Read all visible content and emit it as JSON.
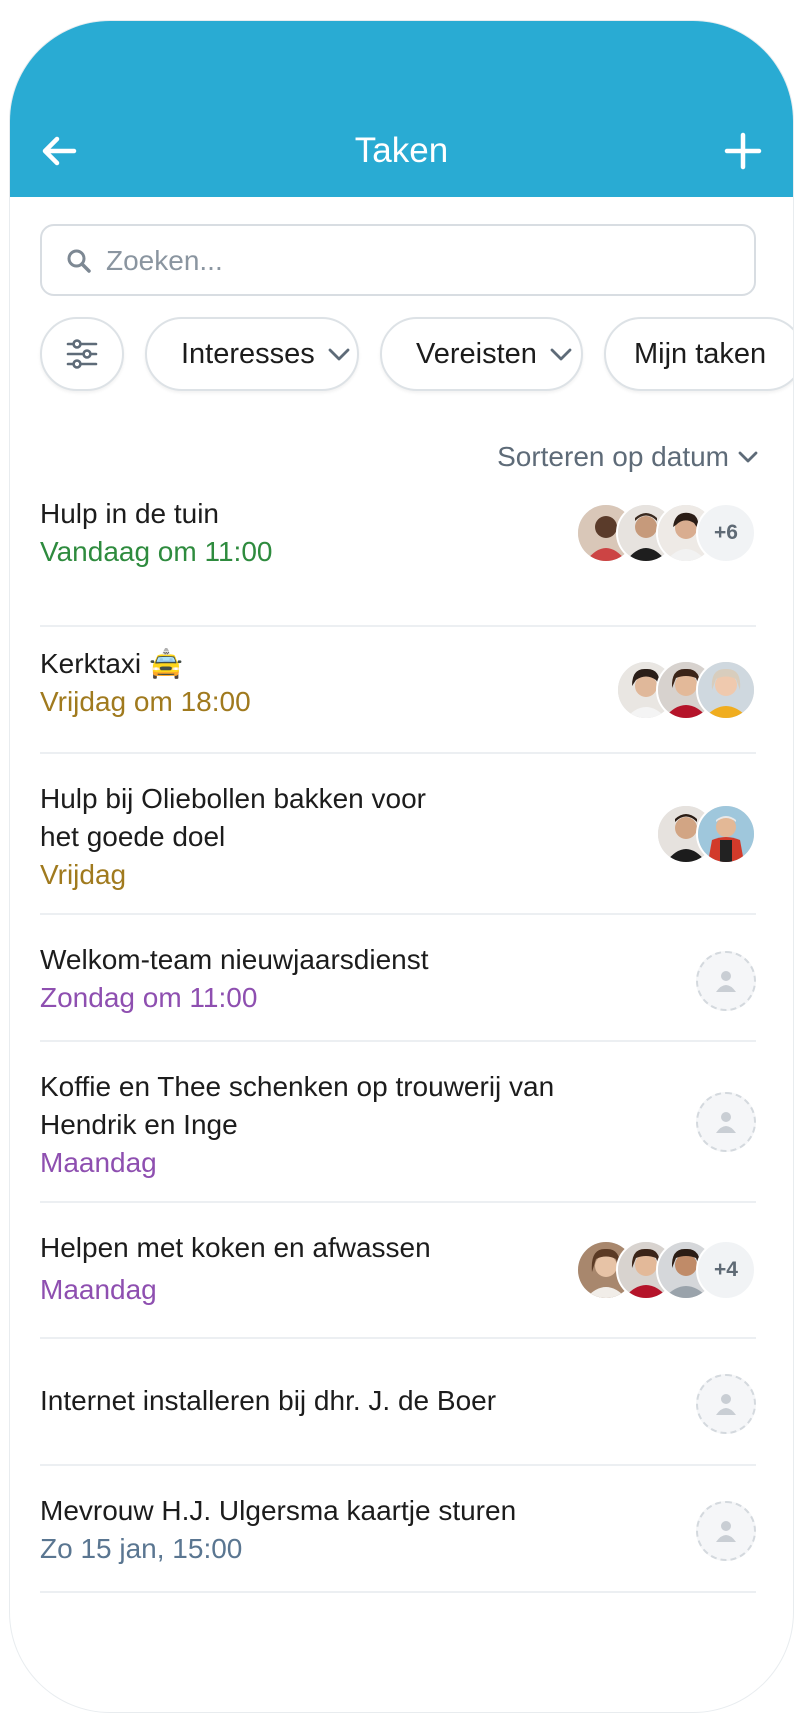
{
  "header": {
    "title": "Taken",
    "back_icon": "arrow-left-icon",
    "add_icon": "plus-icon",
    "color": "#29abd3"
  },
  "search": {
    "placeholder": "Zoeken...",
    "value": ""
  },
  "filters": {
    "interests": "Interesses",
    "requirements": "Vereisten",
    "my_tasks": "Mijn taken"
  },
  "sort": {
    "label": "Sorteren op datum"
  },
  "colors": {
    "today": "#2e8b3e",
    "friday": "#a07a1e",
    "upcoming": "#8e4fb0",
    "later": "#5a7691"
  },
  "tasks": [
    {
      "name": "Hulp in de tuin",
      "when": "Vandaag om 11:00",
      "more": "+6"
    },
    {
      "name": "Kerktaxi 🚖",
      "when": "Vrijdag om 18:00"
    },
    {
      "name": "Hulp bij Oliebollen bakken voor het goede doel",
      "when": "Vrijdag"
    },
    {
      "name": "Welkom-team nieuwjaarsdienst",
      "when": "Zondag om 11:00"
    },
    {
      "name": "Koffie en Thee schenken op trouwerij van Hendrik en Inge",
      "when": "Maandag"
    },
    {
      "name": "Helpen met koken en afwassen",
      "when": "Maandag",
      "more": "+4"
    },
    {
      "name": "Internet installeren bij dhr. J. de Boer",
      "when": ""
    },
    {
      "name": "Mevrouw H.J. Ulgersma kaartje sturen",
      "when": "Zo 15 jan, 15:00"
    }
  ]
}
